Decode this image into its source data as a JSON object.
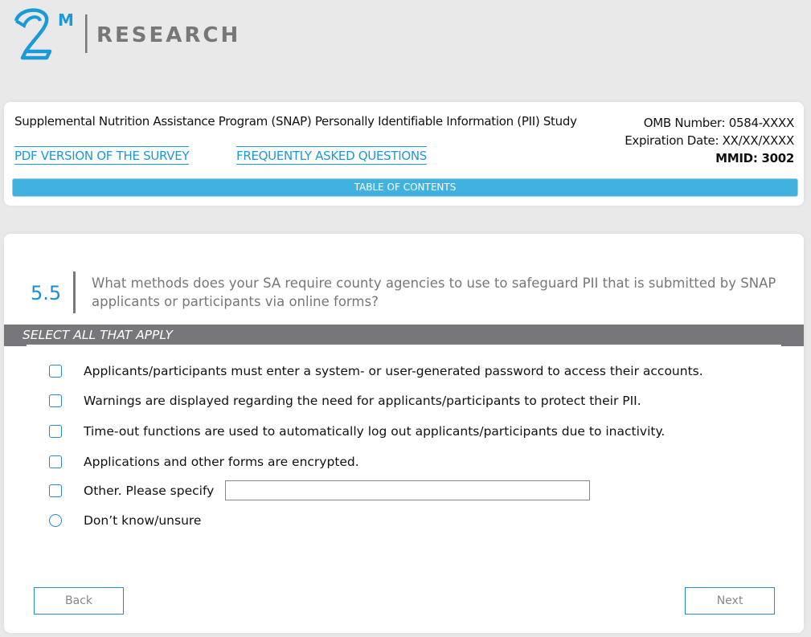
{
  "logo": {
    "mark": "2M",
    "text": "RESEARCH"
  },
  "header": {
    "study_title": "Supplemental Nutrition Assistance Program (SNAP) Personally Identifiable Information (PII) Study",
    "omb": "OMB Number: 0584-XXXX",
    "expiration": "Expiration Date: XX/XX/XXXX",
    "mmid": "MMID: 3002",
    "pdf_link": "PDF VERSION OF THE SURVEY",
    "faq_link": "FREQUENTLY ASKED QUESTIONS",
    "toc": "TABLE OF CONTENTS"
  },
  "question": {
    "number": "5.5",
    "text": "What methods does your SA require county agencies to use to safeguard PII that is submitted by SNAP applicants or participants via online forms?",
    "instruction": "SELECT ALL THAT APPLY",
    "options": [
      "Applicants/participants must enter a system- or user-generated password to access their accounts.",
      "Warnings are displayed regarding the need for applicants/participants to protect their PII.",
      "Time-out functions are used to automatically log out applicants/participants due to inactivity.",
      "Applications and other forms are encrypted.",
      "Other. Please specify",
      "Don’t know/unsure"
    ],
    "other_value": ""
  },
  "nav": {
    "back": "Back",
    "next": "Next"
  }
}
